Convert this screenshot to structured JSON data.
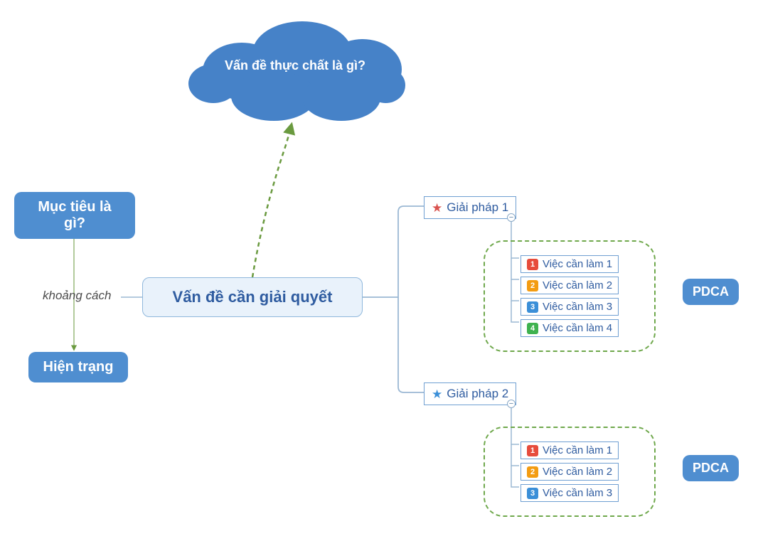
{
  "cloud_question": "Vấn đề thực chất là gì?",
  "left": {
    "goal": "Mục tiêu là gì?",
    "gap": "khoảng cách",
    "current": "Hiện trạng"
  },
  "central": "Vấn đề cần giải quyết",
  "solutions": [
    {
      "label": "Giải pháp 1",
      "star_color": "#d9534f",
      "tasks": [
        {
          "n": "1",
          "label": "Việc cần làm 1",
          "color": "#e74c3c"
        },
        {
          "n": "2",
          "label": "Việc cần làm 2",
          "color": "#f39c12"
        },
        {
          "n": "3",
          "label": "Việc cần làm 3",
          "color": "#3b8fd8"
        },
        {
          "n": "4",
          "label": "Việc cần làm 4",
          "color": "#3fb24f"
        }
      ]
    },
    {
      "label": "Giải pháp 2",
      "star_color": "#3b8fd8",
      "tasks": [
        {
          "n": "1",
          "label": "Việc cần làm 1",
          "color": "#e74c3c"
        },
        {
          "n": "2",
          "label": "Việc cần làm 2",
          "color": "#f39c12"
        },
        {
          "n": "3",
          "label": "Việc cần làm 3",
          "color": "#3b8fd8"
        }
      ]
    }
  ],
  "pdca": "PDCA",
  "collapse_glyph": "−"
}
